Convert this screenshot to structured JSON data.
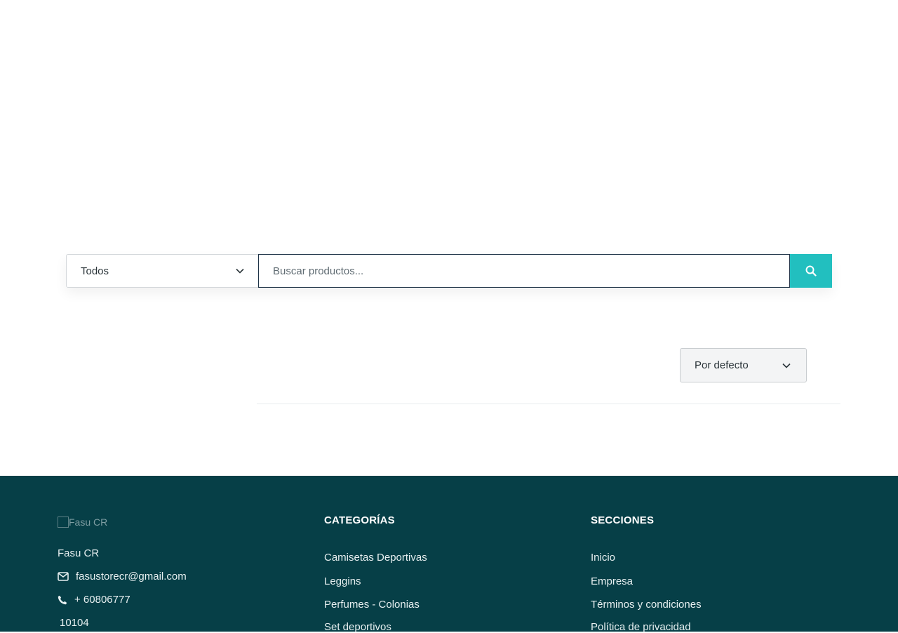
{
  "search": {
    "category_selected": "Todos",
    "placeholder": "Buscar productos..."
  },
  "sort": {
    "selected": "Por defecto"
  },
  "footer": {
    "logo_alt": "Fasu CR",
    "company_name": "Fasu CR",
    "email": "fasustorecr@gmail.com",
    "phone": "+ 60806777",
    "postal_code": "10104",
    "categories": {
      "heading": "CATEGORÍAS",
      "items": [
        "Camisetas Deportivas",
        "Leggins",
        "Perfumes - Colonias",
        "Set deportivos"
      ]
    },
    "sections": {
      "heading": "SECCIONES",
      "items": [
        "Inicio",
        "Empresa",
        "Términos y condiciones",
        "Política de privacidad"
      ]
    }
  },
  "colors": {
    "accent": "#22bfbf",
    "footer_bg": "#063f47"
  }
}
